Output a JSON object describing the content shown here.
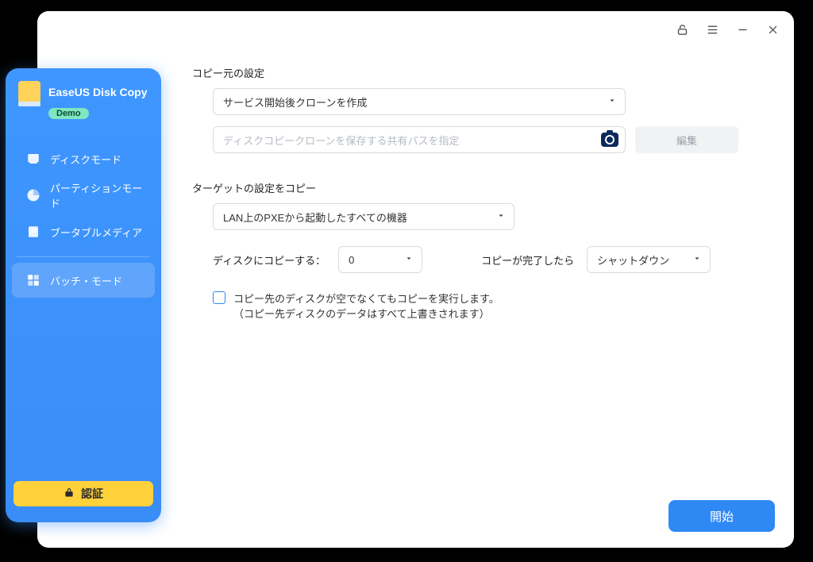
{
  "brand": {
    "title": "EaseUS Disk Copy",
    "badge": "Demo"
  },
  "sidebar": {
    "items": [
      {
        "label": "ディスクモード",
        "icon": "disk-icon"
      },
      {
        "label": "パーティションモード",
        "icon": "partition-icon"
      },
      {
        "label": "ブータブルメディア",
        "icon": "bootable-icon"
      },
      {
        "label": "バッチ・モード",
        "icon": "batch-icon"
      }
    ],
    "verify_label": "認証"
  },
  "titlebar": {
    "lock": "lock-icon",
    "menu": "menu-icon",
    "minimize": "minimize-icon",
    "close": "close-icon"
  },
  "source": {
    "section_title": "コピー元の設定",
    "clone_timing": "サービス開始後クローンを作成",
    "path_placeholder": "ディスクコピークローンを保存する共有パスを指定",
    "edit_label": "編集"
  },
  "target": {
    "section_title": "ターゲットの設定をコピー",
    "scope": "LAN上のPXEから起動したすべての機器",
    "copy_to_label": "ディスクにコピーする：",
    "copy_to_value": "0",
    "after_label": "コピーが完了したら",
    "after_value": "シャットダウン",
    "force_copy_line1": "コピー先のディスクが空でなくてもコピーを実行します。",
    "force_copy_line2": "（コピー先ディスクのデータはすべて上書きされます）"
  },
  "footer": {
    "start_label": "開始"
  }
}
